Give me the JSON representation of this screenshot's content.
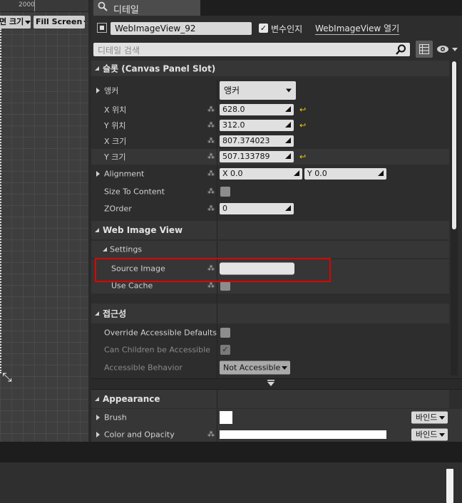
{
  "viewport": {
    "ruler_label": "2000",
    "size_button": "면 크기",
    "fill_screen_button": "Fill Screen"
  },
  "details": {
    "tab_label": "디테일",
    "tab_icon": "magnifier-icon",
    "widget_name": "WebImageView_92",
    "is_variable_label": "변수인지",
    "is_variable_checked": true,
    "open_link": "WebImageView 열기",
    "search_placeholder": "디테일 검색"
  },
  "slot": {
    "title": "슬롯 (Canvas Panel Slot)",
    "anchor_label": "앵커",
    "anchor_value": "앵커",
    "x_pos_label": "X 위치",
    "x_pos": "628.0",
    "y_pos_label": "Y 위치",
    "y_pos": "312.0",
    "x_size_label": "X 크기",
    "x_size": "807.374023",
    "y_size_label": "Y 크기",
    "y_size": "507.133789",
    "alignment_label": "Alignment",
    "alignment_x": "X  0.0",
    "alignment_y": "Y  0.0",
    "size_to_content_label": "Size To Content",
    "zorder_label": "ZOrder",
    "zorder": "0"
  },
  "web_image_view": {
    "title": "Web Image View",
    "settings_label": "Settings",
    "source_image_label": "Source Image",
    "source_image_value": "",
    "use_cache_label": "Use Cache"
  },
  "accessibility": {
    "title": "접근성",
    "override_label": "Override Accessible Defaults",
    "can_children_label": "Can Children be Accessible",
    "behavior_label": "Accessible Behavior",
    "behavior_value": "Not Accessible"
  },
  "appearance": {
    "title": "Appearance",
    "brush_label": "Brush",
    "color_label": "Color and Opacity",
    "bind_button": "바인드"
  },
  "colors": {
    "highlight": "#e00000",
    "reset_arrow": "#f2d100"
  }
}
